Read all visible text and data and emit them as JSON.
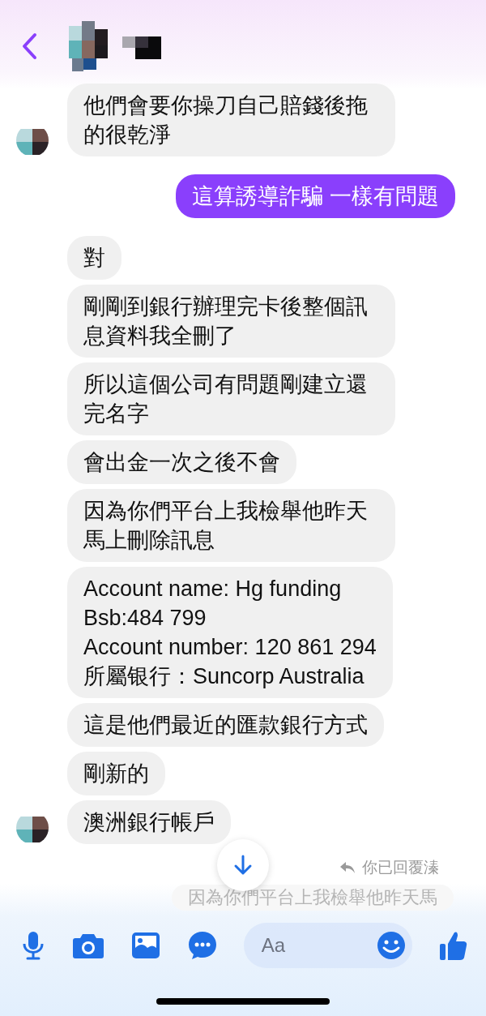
{
  "messages": [
    {
      "kind": "received",
      "text": "他們會要你操刀自己賠錢後拖的很乾淨",
      "avatar": true
    },
    {
      "kind": "sent",
      "text": "這算誘導詐騙 一樣有問題"
    },
    {
      "kind": "received",
      "text": "對",
      "avatar": false
    },
    {
      "kind": "received",
      "text": "剛剛到銀行辦理完卡後整個訊息資料我全刪了",
      "avatar": false
    },
    {
      "kind": "received",
      "text": "所以這個公司有問題剛建立還完名字",
      "avatar": false
    },
    {
      "kind": "received",
      "text": "會出金一次之後不會",
      "avatar": false
    },
    {
      "kind": "received",
      "text": "因為你們平台上我檢舉他昨天馬上刪除訊息",
      "avatar": false
    },
    {
      "kind": "received",
      "text": "Account name: Hg funding\nBsb:484 799\nAccount number: 120 861 294\n所屬银行：Suncorp Australia",
      "avatar": false
    },
    {
      "kind": "received",
      "text": "這是他們最近的匯款銀行方式",
      "avatar": false
    },
    {
      "kind": "received",
      "text": "剛新的",
      "avatar": false
    },
    {
      "kind": "received",
      "text": "澳洲銀行帳戶",
      "avatar": true
    }
  ],
  "reply_note": {
    "text": "你已回覆溱"
  },
  "quoted_reply": {
    "text": "因為你們平台上我檢舉他昨天馬"
  },
  "composer": {
    "placeholder": "Aa"
  }
}
